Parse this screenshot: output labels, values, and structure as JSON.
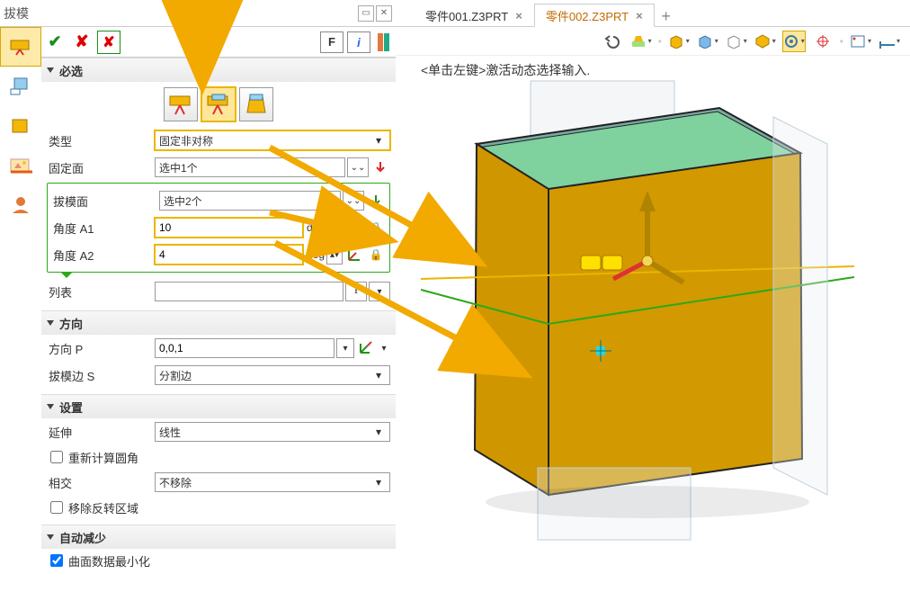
{
  "panel": {
    "title": "拔模",
    "toolbar": {
      "f_label": "F",
      "info_label": "i"
    }
  },
  "sections": {
    "mandatory_title": "必选",
    "direction_title": "方向",
    "settings_title": "设置",
    "autoreduce_title": "自动减少"
  },
  "mandatory": {
    "type_label": "类型",
    "type_value": "固定非对称",
    "fixed_face_label": "固定面",
    "fixed_face_value": "选中1个",
    "draft_face_label": "拔模面",
    "draft_face_value": "选中2个",
    "angle_a1_label": "角度 A1",
    "angle_a1_value": "10",
    "angle_a1_unit": "deg",
    "angle_a2_label": "角度 A2",
    "angle_a2_value": "4",
    "angle_a2_unit": "deg",
    "list_label": "列表",
    "list_value": ""
  },
  "direction": {
    "p_label": "方向 P",
    "p_value": "0,0,1",
    "edge_label": "拔模边 S",
    "edge_value": "分割边"
  },
  "settings": {
    "extend_label": "延伸",
    "extend_value": "线性",
    "recalc_fillet_label": "重新计算圆角",
    "intersect_label": "相交",
    "intersect_value": "不移除",
    "remove_invert_label": "移除反转区域"
  },
  "autoreduce": {
    "minimize_label": "曲面数据最小化"
  },
  "tabs": {
    "tab1": "零件001.Z3PRT",
    "tab2": "零件002.Z3PRT"
  },
  "hint_text": "<单击左键>激活动态选择输入.",
  "colors": {
    "accent_orange": "#eab600",
    "accent_green": "#2da81a"
  }
}
